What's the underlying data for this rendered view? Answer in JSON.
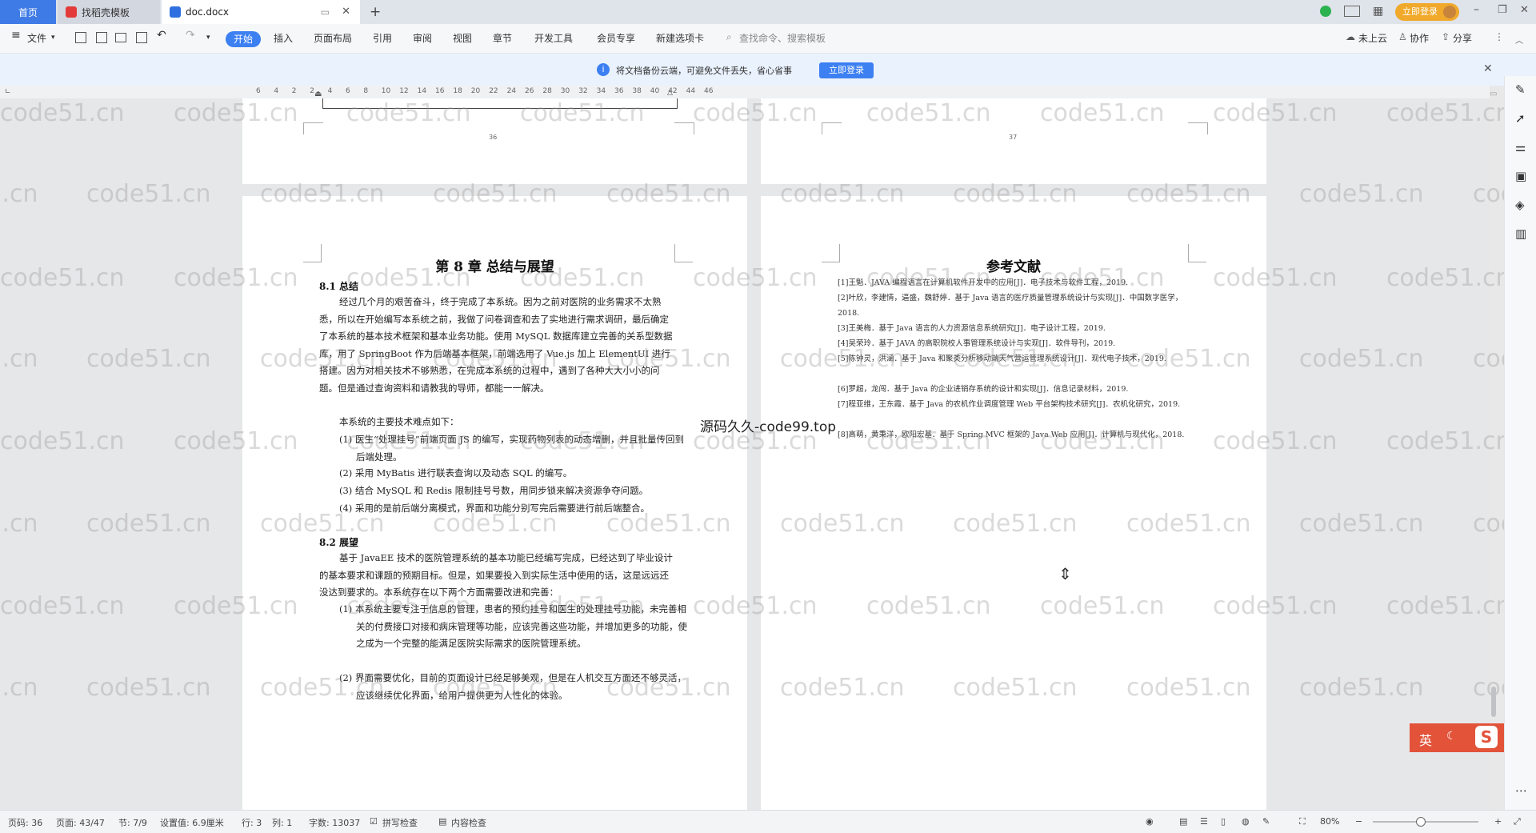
{
  "titlebar": {
    "tabs": [
      {
        "label": "首页"
      },
      {
        "label": "找稻壳模板"
      },
      {
        "label": "doc.docx"
      }
    ],
    "login_button": "立即登录"
  },
  "toolbar": {
    "file_menu": "文件",
    "ribbon_tabs": [
      "开始",
      "插入",
      "页面布局",
      "引用",
      "审阅",
      "视图",
      "章节",
      "开发工具",
      "会员专享",
      "新建选项卡"
    ],
    "search_placeholder": "查找命令、搜索模板",
    "cloud_status": "未上云",
    "collaborate": "协作",
    "share": "分享"
  },
  "notice": {
    "text": "将文档备份云端，可避免文件丢失，省心省事",
    "button": "立即登录"
  },
  "ruler": {
    "ticks": [
      "6",
      "4",
      "2",
      "2",
      "4",
      "6",
      "8",
      "10",
      "12",
      "14",
      "16",
      "18",
      "20",
      "22",
      "24",
      "26",
      "28",
      "30",
      "32",
      "34",
      "36",
      "38",
      "40",
      "42",
      "44",
      "46"
    ]
  },
  "document": {
    "page_numbers": [
      "36",
      "37"
    ],
    "left_page": {
      "title": "第 8 章  总结与展望",
      "section1": "8.1 总结",
      "para1": "经过几个月的艰苦奋斗，终于完成了本系统。因为之前对医院的业务需求不太熟悉，所以在开始编写本系统之前，我做了问卷调查和去了实地进行需求调研，最后确定了本系统的基本技术框架和基本业务功能。使用 MySQL 数据库建立完善的关系型数据库，用了 SpringBoot 作为后端基本框架，前端选用了 Vue.js 加上 ElementUI 进行搭建。因为对相关技术不够熟悉，在完成本系统的过程中，遇到了各种大大小小的问题。但是通过查询资料和请教我的导师，都能一一解决。",
      "para2": "本系统的主要技术难点如下：",
      "points1": [
        "(1) 医生“处理挂号”前端页面 JS 的编写，实现药物列表的动态增删，并且批量传回到后端处理。",
        "(2) 采用 MyBatis 进行联表查询以及动态 SQL 的编写。",
        "(3) 结合 MySQL 和 Redis 限制挂号号数，用同步锁来解决资源争夺问题。",
        "(4) 采用的是前后端分离模式，界面和功能分别写完后需要进行前后端整合。"
      ],
      "section2": "8.2 展望",
      "para3": "基于 JavaEE 技术的医院管理系统的基本功能已经编写完成，已经达到了毕业设计的基本要求和课题的预期目标。但是，如果要投入到实际生活中使用的话，这是远远还没达到要求的。本系统存在以下两个方面需要改进和完善：",
      "points2": [
        "(1) 本系统主要专注于信息的管理，患者的预约挂号和医生的处理挂号功能，未完善相关的付费接口对接和病床管理等功能，应该完善这些功能，并增加更多的功能，使之成为一个完整的能满足医院实际需求的医院管理系统。",
        "(2) 界面需要优化，目前的页面设计已经足够美观，但是在人机交互方面还不够灵活，应该继续优化界面，给用户提供更为人性化的体验。"
      ]
    },
    "right_page": {
      "title": "参考文献",
      "references": [
        "[1]王魁．JAVA 编程语言在计算机软件开发中的应用[J]．电子技术与软件工程，2019.",
        "[2]叶欣，李建情，逼盛，魏舒婷．基于 Java 语言的医疗质量管理系统设计与实现[J]．中国数字医学，2018.",
        "[3]王美梅．基于 Java 语言的人力资源信息系统研究[J]．电子设计工程，2019.",
        "[4]吴荣玲．基于 JAVA 的高职院校人事管理系统设计与实现[J]．软件导刊，2019.",
        "[5]陈钟灵，洪涵．基于 Java 和聚类分析移动端天气营运管理系统设计[J]．现代电子技术，2019.",
        "[6]罗超，龙闯．基于 Java 的企业进销存系统的设计和实现[J]．信息记录材料，2019.",
        "[7]程亚维，王东霞．基于 Java 的农机作业调度管理 Web 平台架构技术研究[J]．农机化研究，2019.",
        "[8]高萌，黄秉洋，欧阳宏基．基于 Spring MVC 框架的 Java Web 应用[J]．计算机与现代化，2018."
      ]
    },
    "overlay_text": "源码久久-code99.top",
    "watermark": "code51.cn"
  },
  "ime": {
    "label": "英"
  },
  "statusbar": {
    "page_num": "页码: 36",
    "page_count": "页面: 43/47",
    "section": "节: 7/9",
    "position": "设置值: 6.9厘米",
    "row": "行: 3",
    "col": "列: 1",
    "word_count": "字数: 13037",
    "spell_check": "拼写检查",
    "content_check": "内容检查",
    "zoom": "80%"
  },
  "colors": {
    "accent": "#3c80f2",
    "ime": "#e2533a",
    "home_tab": "#3f7be6"
  }
}
